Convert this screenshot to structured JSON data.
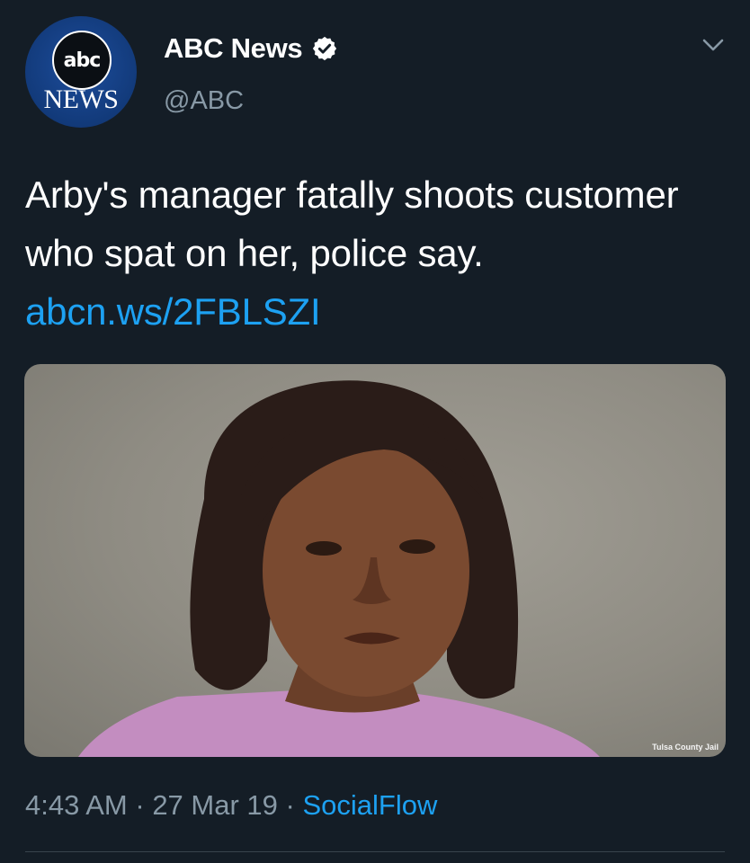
{
  "account": {
    "display_name": "ABC News",
    "handle": "@ABC",
    "avatar_logo_top": "abc",
    "avatar_logo_bottom": "NEWS",
    "verified": true
  },
  "tweet": {
    "text": "Arby's manager fatally shoots customer who spat on her, police say. ",
    "link": "abcn.ws/2FBLSZI"
  },
  "media": {
    "watermark": "Tulsa County Jail"
  },
  "meta": {
    "time": "4:43 AM",
    "sep1": " · ",
    "date": "27 Mar 19",
    "sep2": " · ",
    "source": "SocialFlow"
  },
  "colors": {
    "background": "#141d26",
    "link": "#1da1f2",
    "secondary_text": "#8899a6"
  },
  "icons": [
    "verified-badge-icon",
    "chevron-down-icon"
  ]
}
